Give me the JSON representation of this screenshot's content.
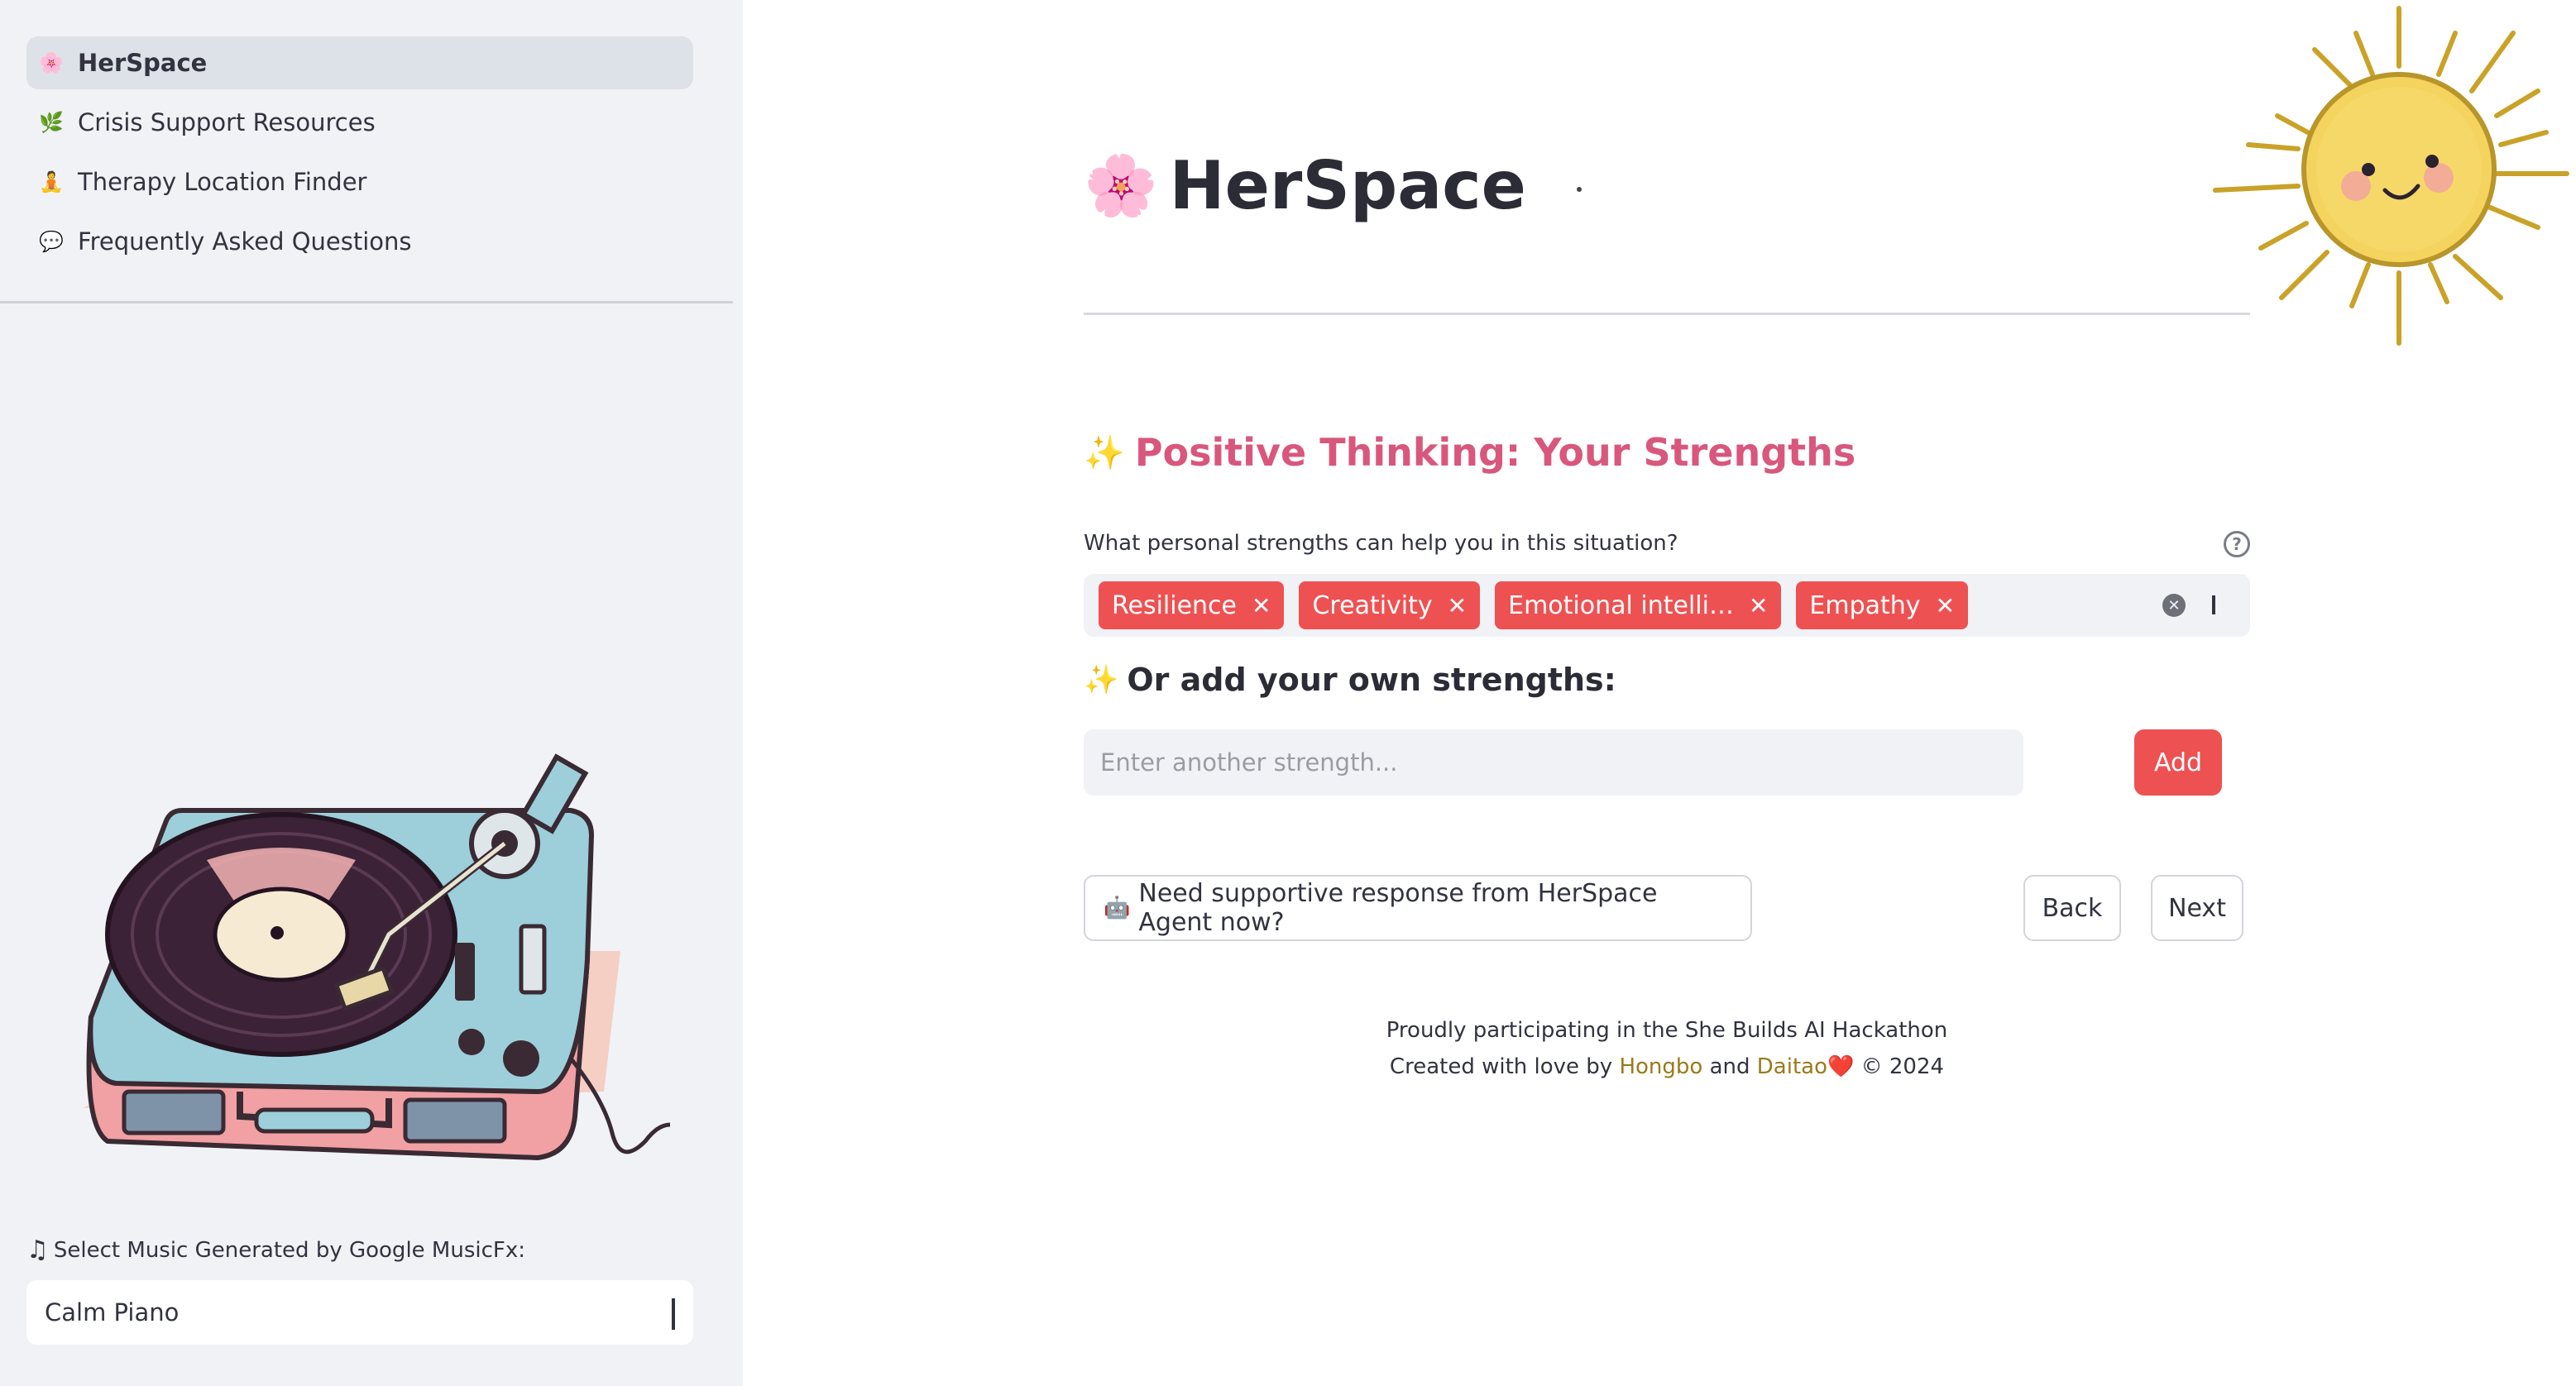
{
  "sidebar": {
    "nav": [
      {
        "label": "HerSpace",
        "icon": "🌸",
        "icon_name": "cherry-blossom-icon",
        "active": true
      },
      {
        "label": "Crisis Support Resources",
        "icon": "🌿",
        "icon_name": "herb-icon",
        "active": false
      },
      {
        "label": "Therapy Location Finder",
        "icon": "🧘",
        "icon_name": "meditation-icon",
        "active": false
      },
      {
        "label": "Frequently Asked Questions",
        "icon": "💬",
        "icon_name": "speech-bubble-icon",
        "active": false
      }
    ],
    "music": {
      "label": "Select Music Generated by Google MusicFx:",
      "selected": "Calm Piano"
    }
  },
  "main": {
    "title": "HerSpace",
    "section_title": "Positive Thinking: Your Strengths",
    "question": "What personal strengths can help you in this situation?",
    "strengths": [
      "Resilience",
      "Creativity",
      "Emotional intelli…",
      "Empathy"
    ],
    "own_strengths_title": "Or add your own strengths:",
    "strength_placeholder": "Enter another strength...",
    "add_label": "Add",
    "agent_button": "Need supportive response from HerSpace Agent now?",
    "back_label": "Back",
    "next_label": "Next",
    "footer": {
      "line1": "Proudly participating in the She Builds AI Hackathon",
      "created_prefix": "Created with love by",
      "author1": "Hongbo",
      "and": "and",
      "author2": "Daitao",
      "suffix": "© 2024"
    }
  },
  "colors": {
    "accent": "#ee5152",
    "section_title": "#d9577c",
    "sidebar_bg": "#f0f2f6",
    "link": "#9a7a1a"
  }
}
